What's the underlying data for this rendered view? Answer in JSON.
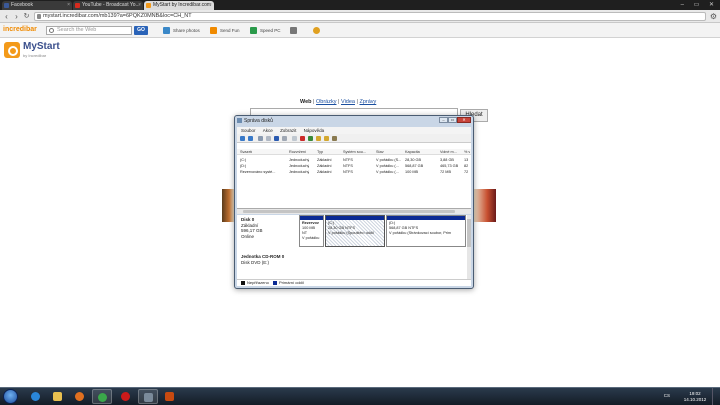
{
  "browser": {
    "tabs": [
      {
        "label": "Facebook",
        "color": "#3b5998",
        "active": false
      },
      {
        "label": "YouTube - Broadcast Yo...",
        "color": "#d62a1e",
        "active": false
      },
      {
        "label": "MyStart by Incredibar.com",
        "color": "#f39a1a",
        "active": true
      }
    ],
    "url": "mystart.incredibar.com/mb139?a=6PQKZ0MNB&loc=CH_NT"
  },
  "toolbar": {
    "brand": "incredibar",
    "search_placeholder": "Search the Web",
    "go_label": "GO",
    "items": [
      {
        "label": "Share photos",
        "color": "#3a88c8"
      },
      {
        "label": "Send Fun",
        "color": "#f08a00"
      },
      {
        "label": "Speed PC",
        "color": "#2a9a4a"
      },
      {
        "label": "",
        "color": "#777777"
      },
      {
        "label": "",
        "color": "#e0a020"
      }
    ]
  },
  "mystart": {
    "logo_name": "MyStart",
    "logo_by": "by Incredibar",
    "search_tabs": [
      "Web",
      "Obrázky",
      "Videa",
      "Zprávy"
    ],
    "search_button": "Hledat"
  },
  "disk_mgmt": {
    "title": "Správa disků",
    "menu": [
      "Soubor",
      "Akce",
      "Zobrazit",
      "Nápověda"
    ],
    "columns": [
      "Svazek",
      "Rozvržení",
      "Typ",
      "Systém sou...",
      "Stav",
      "Kapacita",
      "Volné m...",
      "% v"
    ],
    "volumes": [
      {
        "name": "(C:)",
        "layout": "Jednoduchý",
        "type": "Základní",
        "fs": "NTFS",
        "status": "V pořádku (S...",
        "capacity": "28,30 GB",
        "free": "3,88 GB",
        "pct": "13"
      },
      {
        "name": "(D:)",
        "layout": "Jednoduchý",
        "type": "Základní",
        "fs": "NTFS",
        "status": "V pořádku (...",
        "capacity": "568,87 GB",
        "free": "465,73 GB",
        "pct": "82"
      },
      {
        "name": "Rezervováno systé...",
        "layout": "Jednoduchý",
        "type": "Základní",
        "fs": "NTFS",
        "status": "V pořádku (...",
        "capacity": "100 MB",
        "free": "72 MB",
        "pct": "72"
      }
    ],
    "disk0": {
      "name": "Disk 0",
      "type": "Základní",
      "size": "596,17 GB",
      "status": "Online",
      "partitions": [
        {
          "name": "Rezervov",
          "size": "100 MB NT",
          "status": "V pořádku"
        },
        {
          "name": "(C:)",
          "size": "28,30 GB NTFS",
          "status": "V pořádku (Spouštěcí oddíl"
        },
        {
          "name": "(D:)",
          "size": "568,87 GB NTFS",
          "status": "V pořádku (Stránkovací soubor, Prim"
        }
      ]
    },
    "cdrom": {
      "name": "Jednotka CD-ROM 0",
      "desc": "Disk DVD (E:)"
    },
    "legend": [
      {
        "label": "Nepřiřazeno",
        "color": "#111111"
      },
      {
        "label": "Primární oddíl",
        "color": "#0b2a94"
      }
    ]
  },
  "taskbar": {
    "apps": [
      {
        "name": "ie",
        "color": "#2a86d8"
      },
      {
        "name": "explorer",
        "color": "#e8c050"
      },
      {
        "name": "media",
        "color": "#e07020"
      },
      {
        "name": "chrome",
        "color": "#3aa84a"
      },
      {
        "name": "opera",
        "color": "#cc1a1a"
      },
      {
        "name": "disk-tool",
        "color": "#7a8a9a"
      },
      {
        "name": "recorder",
        "color": "#c84a10"
      }
    ],
    "lang": "CS",
    "time": "19:02",
    "date": "14.10.2012"
  }
}
